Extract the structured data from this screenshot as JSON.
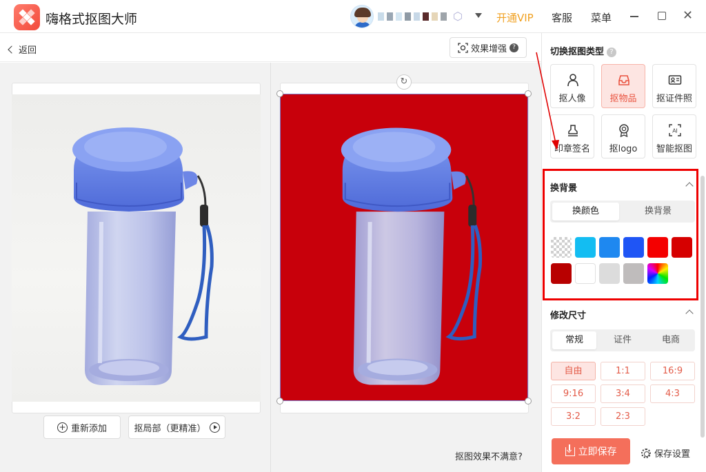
{
  "app": {
    "title": "嗨格式抠图大师",
    "vip_label": "开通VIP",
    "service_label": "客服",
    "menu_label": "菜单",
    "vip_color": "#f0a020"
  },
  "toolbar": {
    "back_label": "返回",
    "enhance_label": "效果增强",
    "enhance_help": "?"
  },
  "canvas": {
    "readd_label": "重新添加",
    "local_label": "抠局部（更精准）",
    "unsatisfied_label": "抠图效果不满意?",
    "result_background": "#c8000b"
  },
  "panel": {
    "type_title": "切换抠图类型",
    "type_help": "?",
    "types": [
      {
        "label": "抠人像",
        "icon": "person-icon",
        "active": false
      },
      {
        "label": "抠物品",
        "icon": "box-icon",
        "active": true
      },
      {
        "label": "抠证件照",
        "icon": "id-card-icon",
        "active": false
      },
      {
        "label": "印章签名",
        "icon": "stamp-icon",
        "active": false
      },
      {
        "label": "抠logo",
        "icon": "badge-icon",
        "active": false
      },
      {
        "label": "智能抠图",
        "icon": "ai-icon",
        "active": false
      }
    ],
    "bg_title": "换背景",
    "bg_tabs": [
      {
        "label": "换颜色",
        "active": true
      },
      {
        "label": "换背景",
        "active": false
      }
    ],
    "swatches": [
      "transparent",
      "#13bdf2",
      "#1e88f0",
      "#1f55f5",
      "#f40000",
      "#d60000",
      "#b80000",
      "#ffffff",
      "#dcdcdc",
      "#bfbcbc",
      "rainbow"
    ],
    "size_title": "修改尺寸",
    "size_tabs": [
      {
        "label": "常规",
        "active": true
      },
      {
        "label": "证件",
        "active": false
      },
      {
        "label": "电商",
        "active": false
      }
    ],
    "sizes": [
      {
        "label": "自由",
        "active": true
      },
      {
        "label": "1:1",
        "active": false
      },
      {
        "label": "16:9",
        "active": false
      },
      {
        "label": "9:16",
        "active": false
      },
      {
        "label": "3:4",
        "active": false
      },
      {
        "label": "4:3",
        "active": false
      },
      {
        "label": "3:2",
        "active": false
      },
      {
        "label": "2:3",
        "active": false
      }
    ],
    "save_label": "立即保存",
    "save_settings_label": "保存设置",
    "accent_color": "#f46f5b"
  }
}
